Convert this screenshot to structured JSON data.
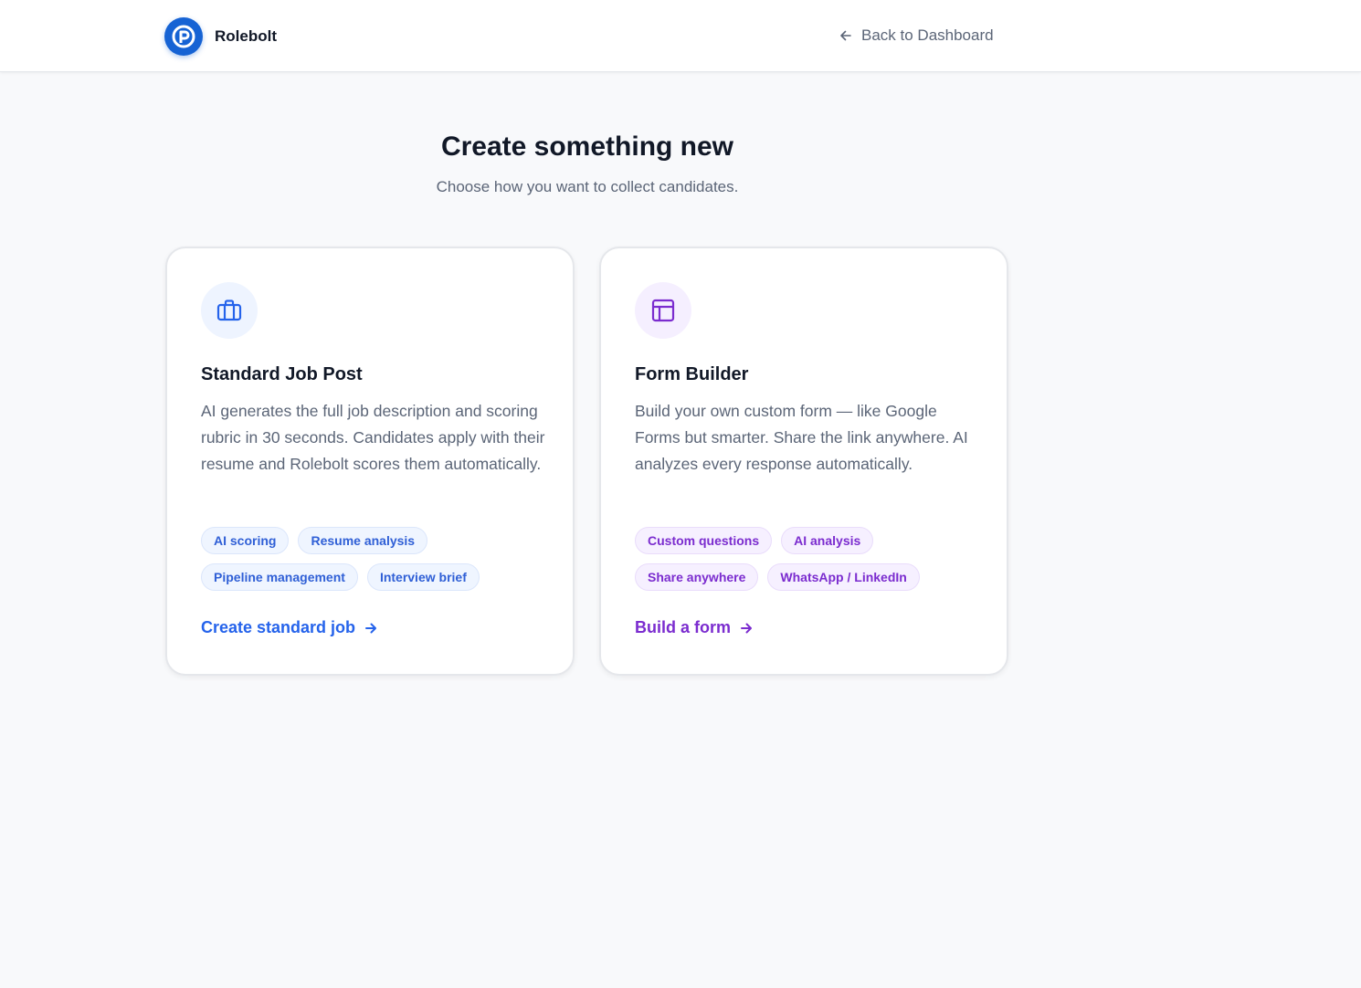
{
  "header": {
    "brand_name": "Rolebolt",
    "back_label": "Back to Dashboard"
  },
  "main": {
    "title": "Create something new",
    "subtitle": "Choose how you want to collect candidates."
  },
  "cards": [
    {
      "icon": "briefcase-icon",
      "title": "Standard Job Post",
      "description": "AI generates the full job description and scoring rubric in 30 seconds. Candidates apply with their resume and Rolebolt scores them automatically.",
      "tags": [
        "AI scoring",
        "Resume analysis",
        "Pipeline management",
        "Interview brief"
      ],
      "cta": "Create standard job",
      "accent": "#2563eb"
    },
    {
      "icon": "layout-icon",
      "title": "Form Builder",
      "description": "Build your own custom form — like Google Forms but smarter. Share the link anywhere. AI analyzes every response automatically.",
      "tags": [
        "Custom questions",
        "AI analysis",
        "Share anywhere",
        "WhatsApp / LinkedIn"
      ],
      "cta": "Build a form",
      "accent": "#7b2ccf"
    }
  ],
  "colors": {
    "brand": "#1663d4",
    "background": "#f8f9fb",
    "text_muted": "#5b6577"
  }
}
